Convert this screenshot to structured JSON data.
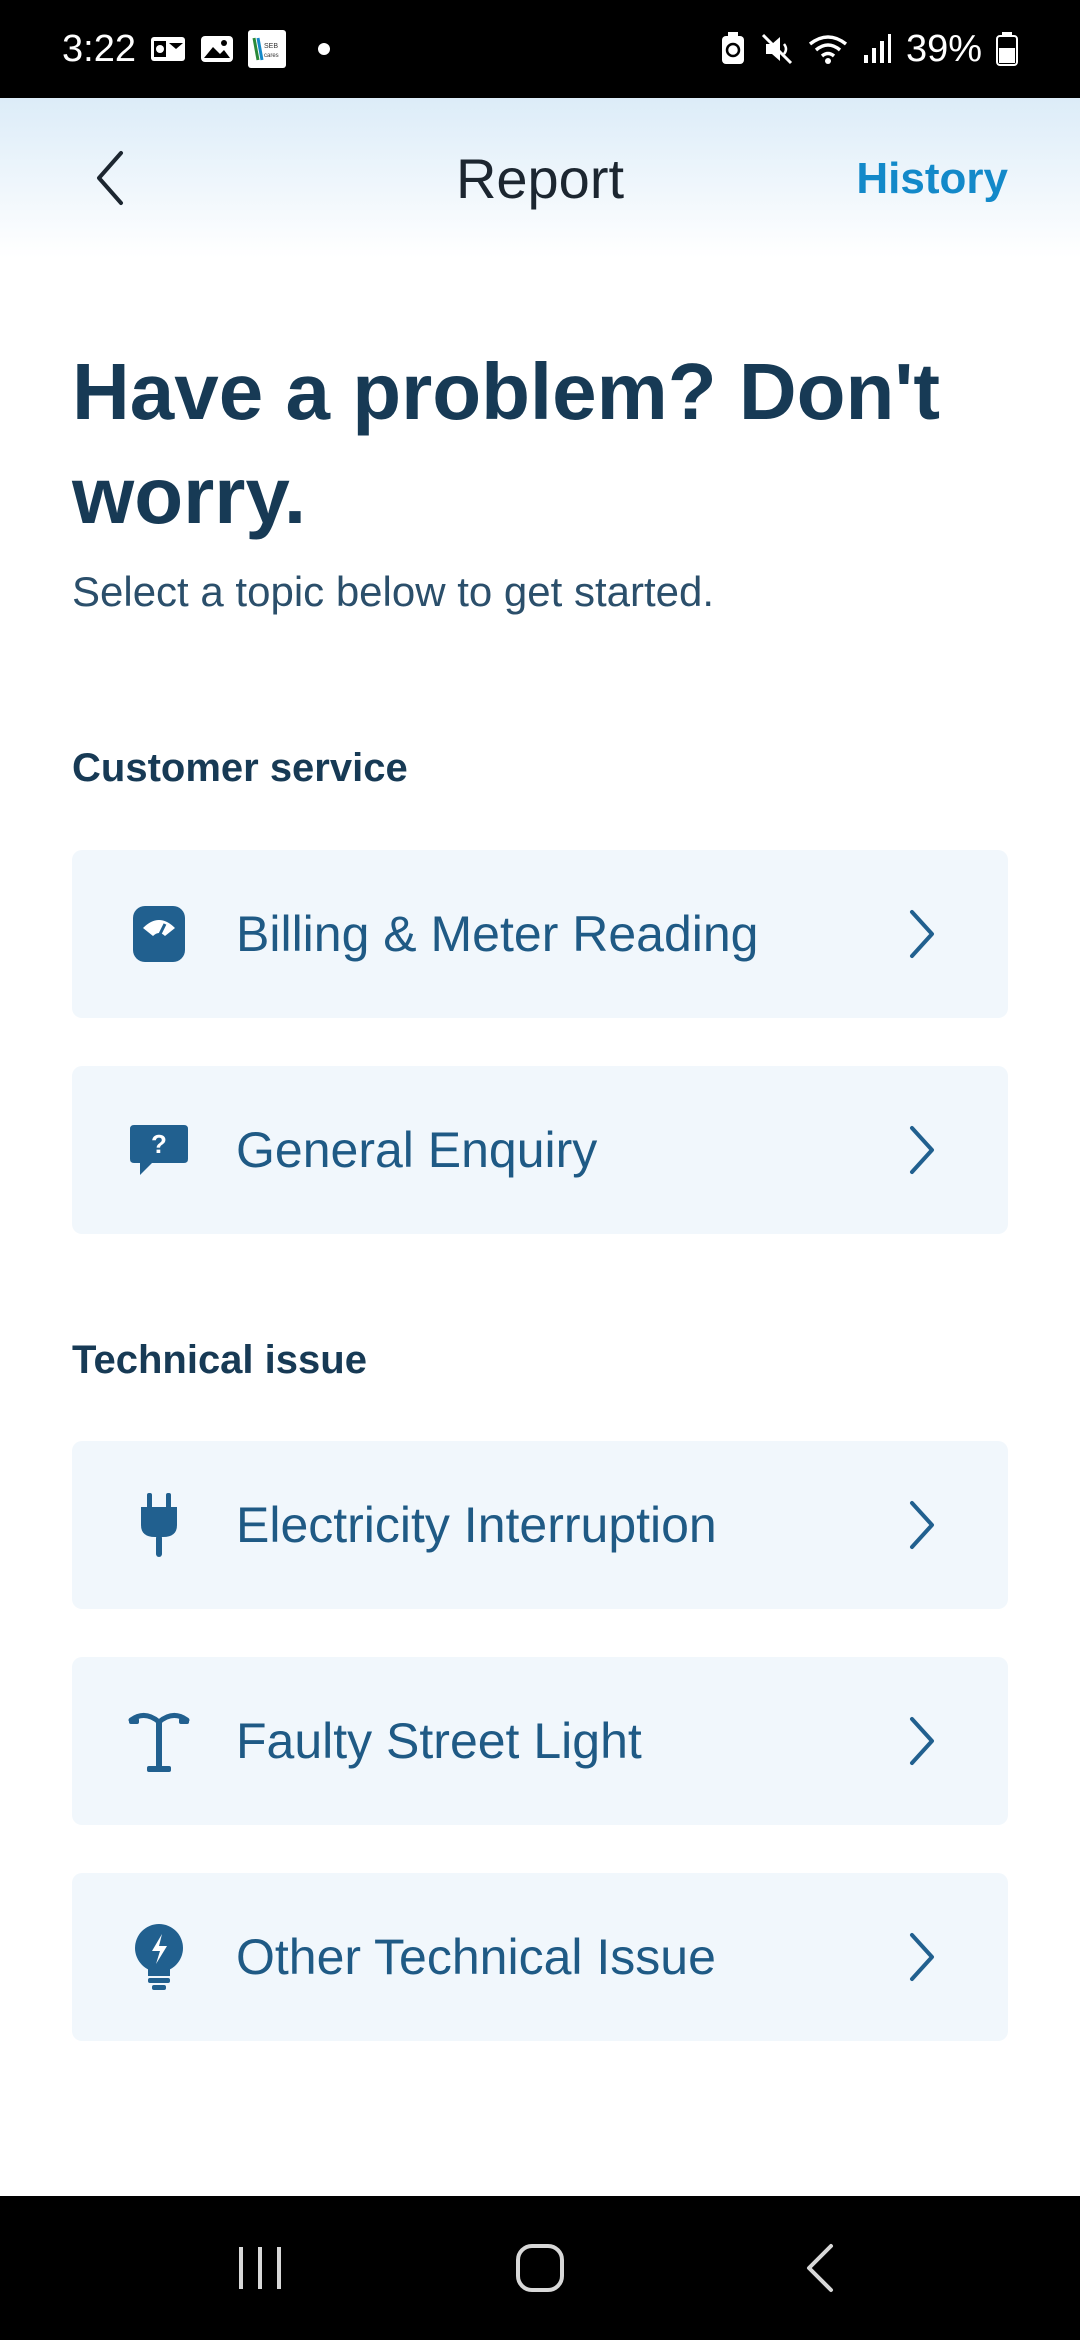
{
  "status_bar": {
    "time": "3:22",
    "battery": "39%",
    "notification_icons": [
      "outlook-icon",
      "gallery-icon",
      "seb-cares-app-icon"
    ],
    "system_icons": [
      "battery-saver-icon",
      "mute-icon",
      "wifi-icon",
      "signal-icon"
    ],
    "app_icon_text": "SEB Cares"
  },
  "header": {
    "title": "Report",
    "history_label": "History",
    "back_icon": "chevron-left-icon"
  },
  "hero": {
    "headline": "Have a problem? Don't worry.",
    "subtitle": "Select a topic below to get started."
  },
  "sections": [
    {
      "label": "Customer service",
      "items": [
        {
          "label": "Billing & Meter Reading",
          "icon": "meter-icon"
        },
        {
          "label": "General Enquiry",
          "icon": "question-bubble-icon"
        }
      ]
    },
    {
      "label": "Technical issue",
      "items": [
        {
          "label": "Electricity Interruption",
          "icon": "plug-icon"
        },
        {
          "label": "Faulty Street Light",
          "icon": "street-light-icon"
        },
        {
          "label": "Other Technical Issue",
          "icon": "lightbulb-bolt-icon"
        }
      ]
    }
  ],
  "colors": {
    "accent": "#1389c9",
    "icon": "#21608f",
    "text_dark": "#173a55",
    "card_bg": "#f1f7fc"
  },
  "nav_bar": {
    "buttons": [
      "recents-icon",
      "home-icon",
      "back-icon"
    ]
  }
}
